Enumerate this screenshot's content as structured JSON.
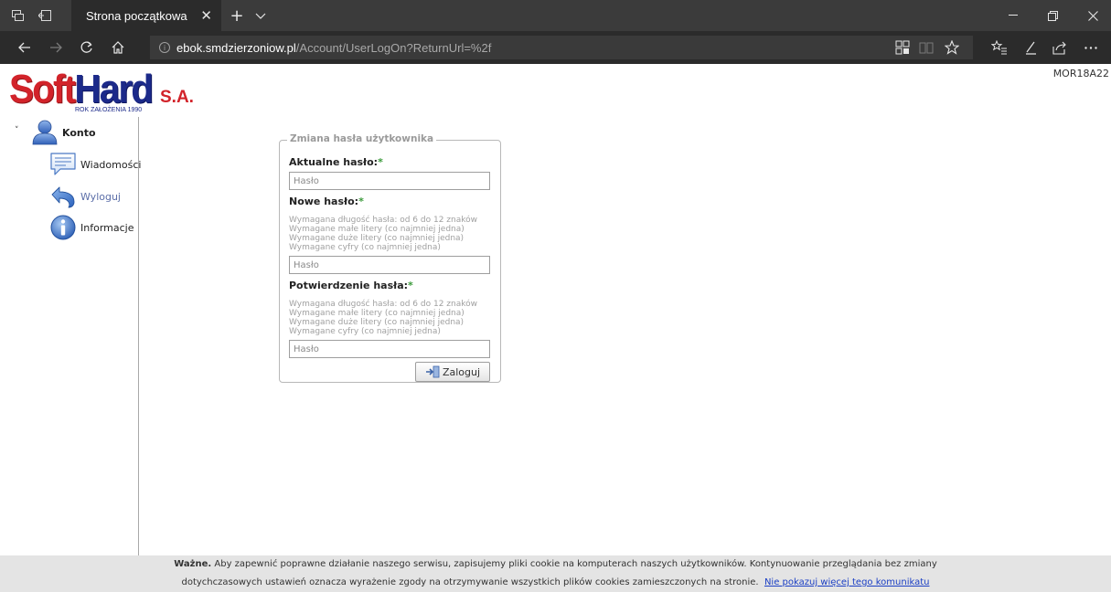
{
  "browser": {
    "tab_title": "Strona początkowa",
    "tab_close": "✕",
    "new_tab": "+",
    "tab_menu": "⌵",
    "url_host": "ebok.smdzierzoniow.pl",
    "url_path": "/Account/UserLogOn?ReturnUrl=%2f",
    "icons": [
      "tab-preview-icon",
      "set-aside-tabs-icon",
      "back-icon",
      "forward-icon",
      "refresh-icon",
      "home-icon",
      "site-info-icon",
      "extension-icon",
      "reading-view-icon",
      "favorite-star-icon",
      "favorites-list-icon",
      "pen-icon",
      "share-icon",
      "more-icon",
      "minimize-icon",
      "maximize-icon",
      "close-icon"
    ]
  },
  "header": {
    "logo_soft": "Soft",
    "logo_hard": "Hard",
    "logo_sa": "S.A.",
    "logo_sub": "ROK ZAŁOŻENIA 1990",
    "version": "MOR18A22"
  },
  "sidebar": {
    "toggle": "˅",
    "items": [
      {
        "label": "Konto",
        "icon": "user-account-icon"
      },
      {
        "label": "Wiadomości",
        "icon": "message-icon"
      },
      {
        "label": "Wyloguj",
        "icon": "logout-arrow-icon"
      },
      {
        "label": "Informacje",
        "icon": "info-icon"
      }
    ]
  },
  "form": {
    "legend": "Zmiana hasła użytkownika",
    "current_label": "Aktualne hasło:",
    "new_label": "Nowe hasło:",
    "confirm_label": "Potwierdzenie hasła:",
    "required_mark": "*",
    "placeholder": "Hasło",
    "hints": [
      "Wymagana długość hasła: od 6 do 12 znaków",
      "Wymagane małe litery (co najmniej jedna)",
      "Wymagane duże litery (co najmniej jedna)",
      "Wymagane cyfry (co najmniej jedna)"
    ],
    "submit_label": "Zaloguj"
  },
  "cookie": {
    "bold": "Ważne.",
    "line1": " Aby zapewnić poprawne działanie naszego serwisu, zapisujemy pliki cookie na komputerach naszych użytkowników. Kontynuowanie przeglądania bez zmiany",
    "line2": "dotychczasowych ustawień oznacza wyrażenie zgody na otrzymywanie wszystkich plików cookies zamieszczonych na stronie.",
    "link": "Nie pokazuj więcej tego komunikatu"
  }
}
